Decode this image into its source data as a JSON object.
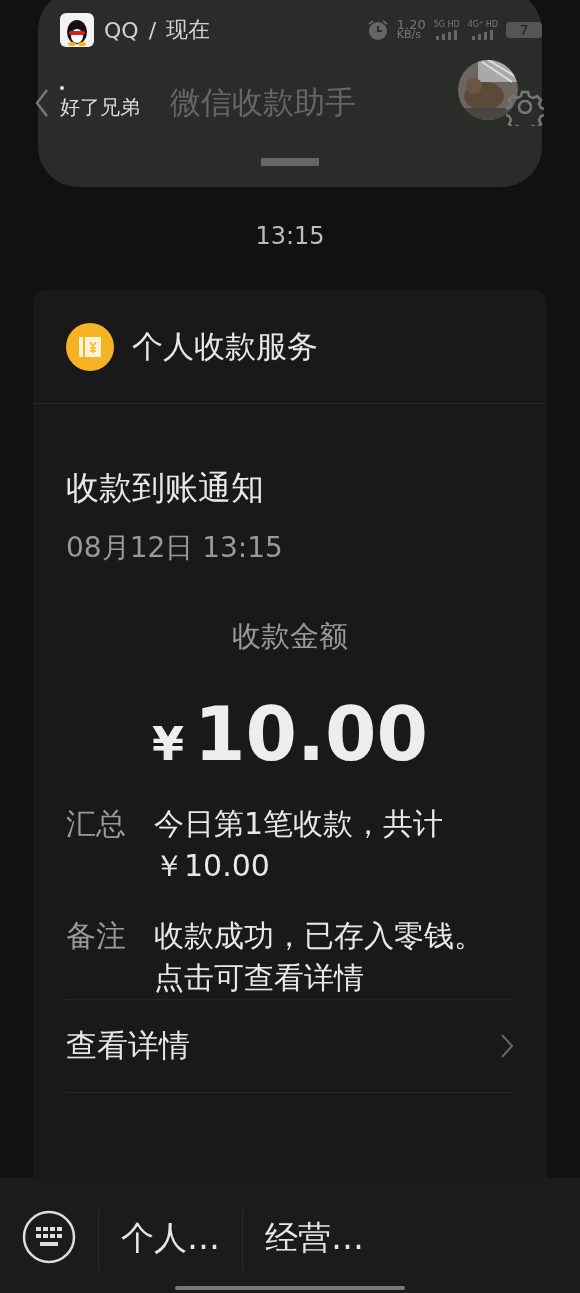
{
  "notification": {
    "app": "QQ",
    "separator": "/",
    "time": "现在",
    "speed": "1.20",
    "speed_unit": "KB/s",
    "networks": [
      "5G HD",
      "4G⁺ HD"
    ],
    "battery": "7"
  },
  "chat_header": {
    "back_label": "好了兄弟",
    "title": "微信收款助手"
  },
  "message_time": "13:15",
  "card": {
    "service": "个人收款服务",
    "title": "收款到账通知",
    "date": "08月12日 13:15",
    "amount_label": "收款金额",
    "currency": "¥",
    "amount": "10.00",
    "fields": [
      {
        "label": "汇总",
        "value": "今日第1笔收款，共计￥10.00"
      },
      {
        "label": "备注",
        "value": "收款成功，已存入零钱。点击可查看详情"
      }
    ],
    "links": [
      "查看详情"
    ]
  },
  "bottom_menu": [
    "个人…",
    "经营…"
  ]
}
